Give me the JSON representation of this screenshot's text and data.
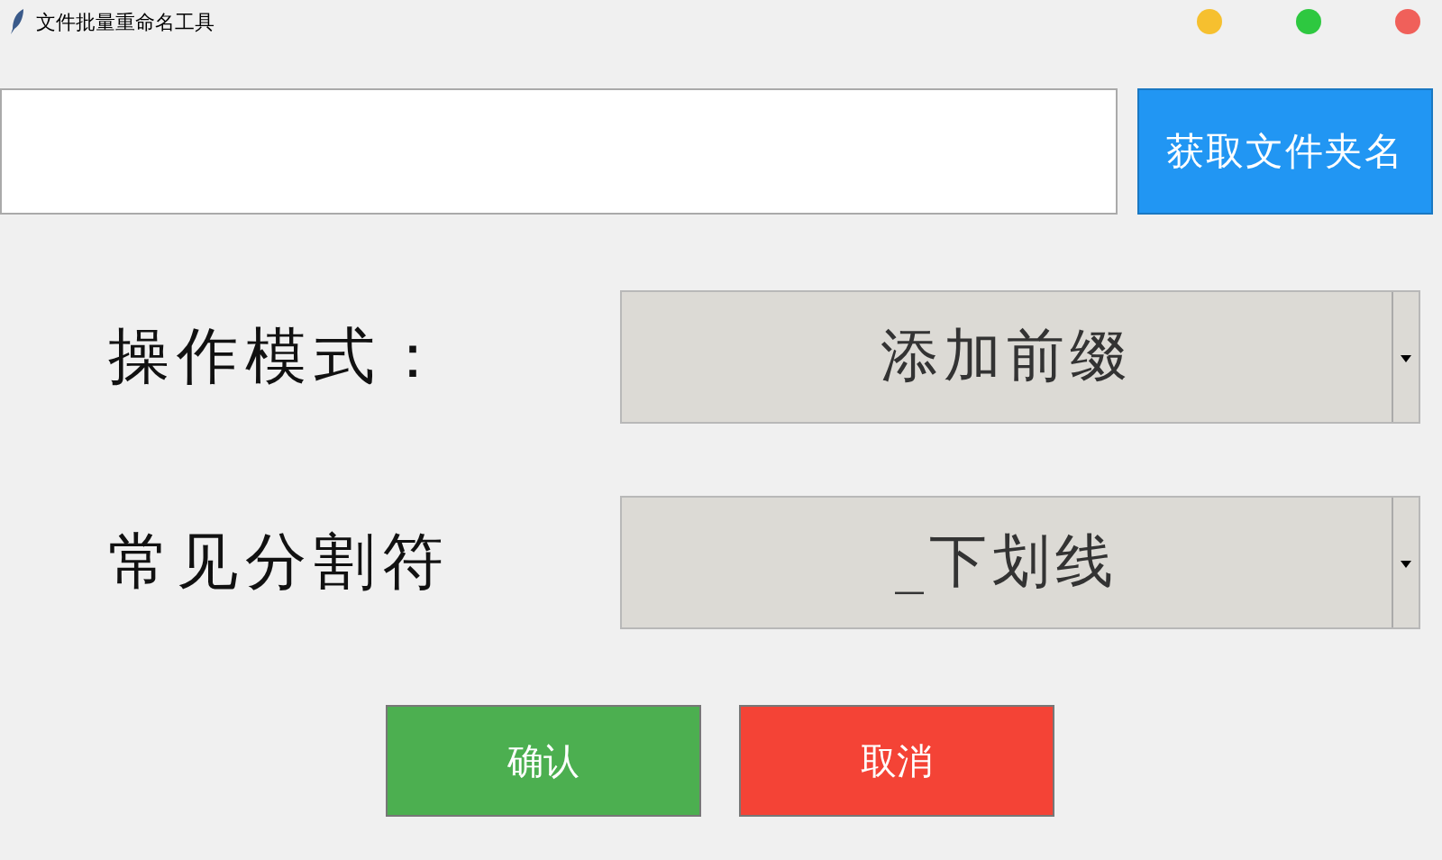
{
  "window": {
    "title": "文件批量重命名工具"
  },
  "folder": {
    "button": "获取文件夹名"
  },
  "fields": [
    {
      "label": "操作模式：",
      "value": "添加前缀"
    },
    {
      "label": "常见分割符",
      "value": "_下划线"
    }
  ],
  "buttons": [
    {
      "label": "确认",
      "kind": "confirm"
    },
    {
      "label": "取消",
      "kind": "cancel"
    }
  ]
}
